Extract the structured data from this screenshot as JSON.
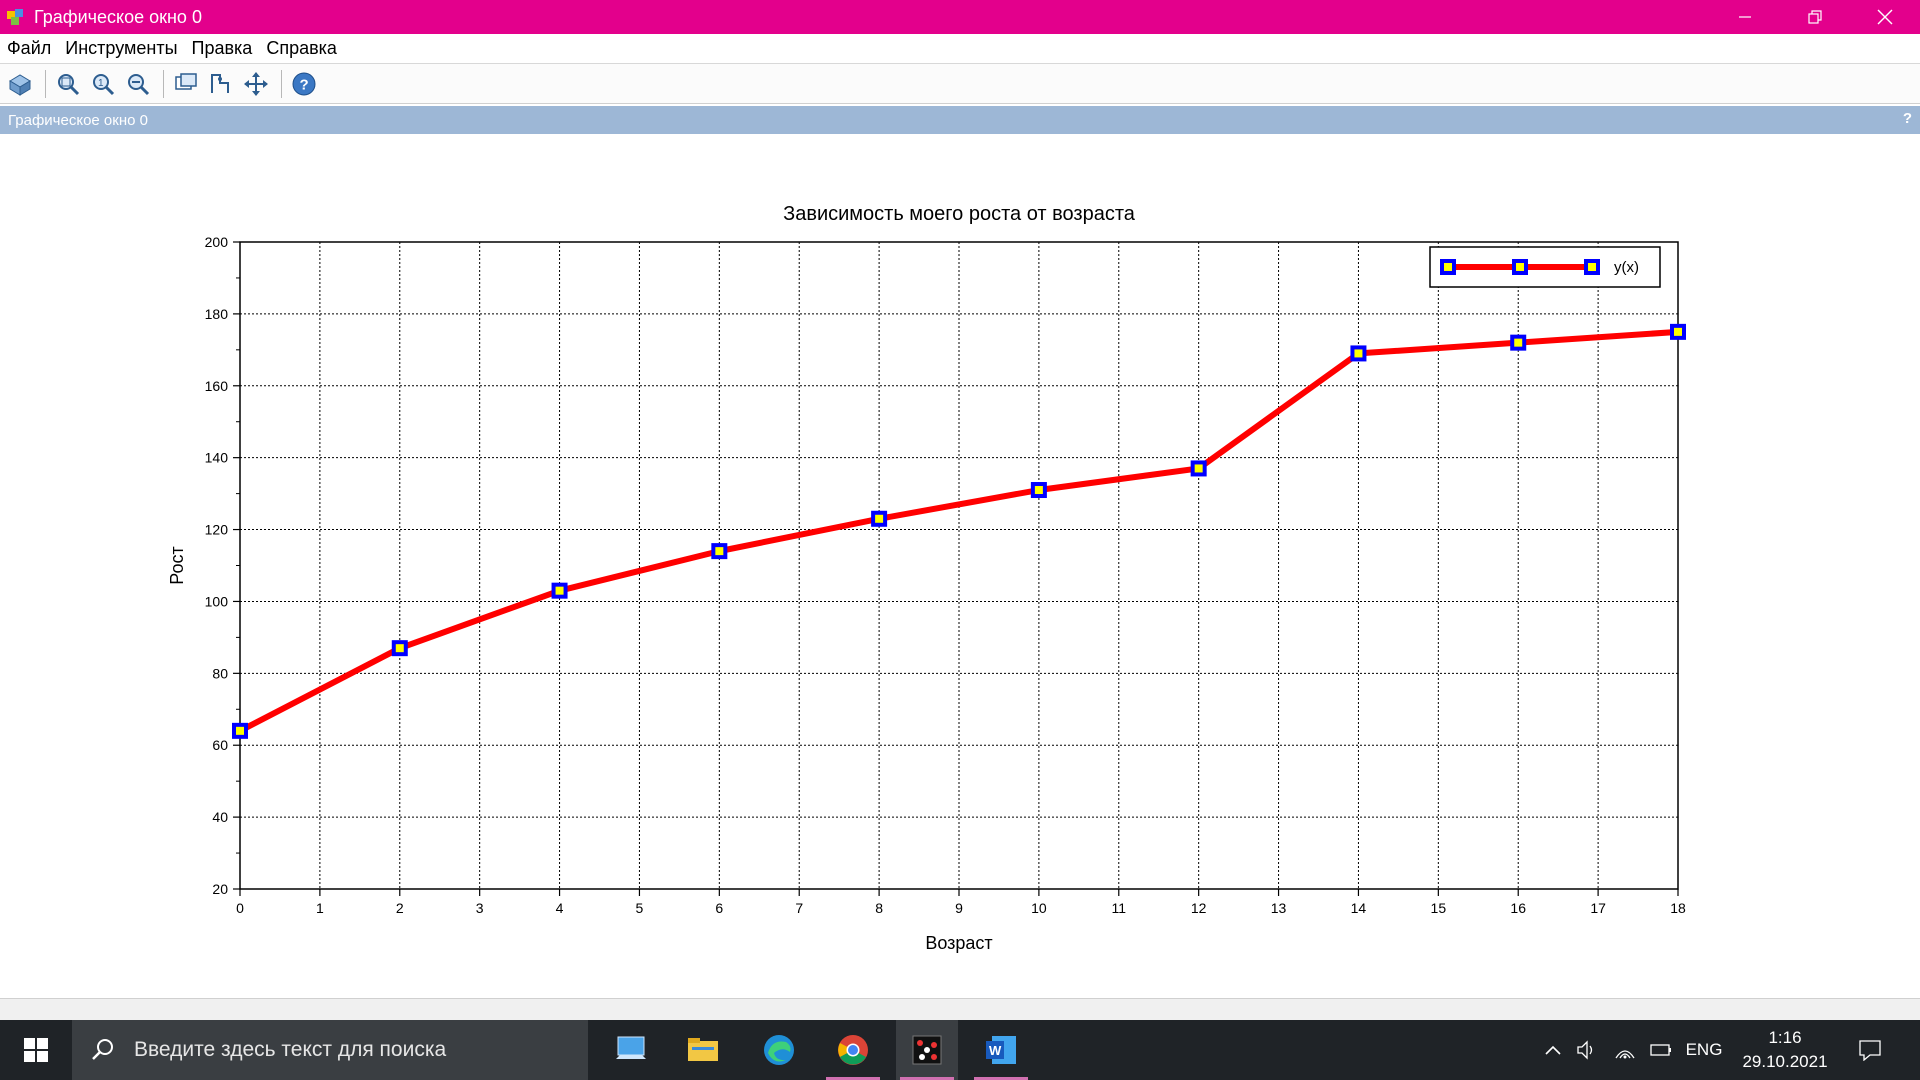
{
  "window": {
    "title": "Графическое окно 0",
    "controls": [
      "minimize",
      "restore",
      "close"
    ]
  },
  "menu": {
    "items": [
      "Файл",
      "Инструменты",
      "Правка",
      "Справка"
    ]
  },
  "toolbar": {
    "icons": [
      "rotate-icon",
      "zoom-area-icon",
      "zoom-in-icon",
      "zoom-out-icon",
      "datatip-icon",
      "edit-curve-icon",
      "pan-icon",
      "help-icon"
    ]
  },
  "panel": {
    "header": "Графическое окно 0",
    "help": "?"
  },
  "colors": {
    "titlebar": "#e3008c",
    "line": "#ff0000",
    "marker_edge": "#0000ff",
    "marker_face": "#ffff00"
  },
  "chart_data": {
    "type": "line",
    "title": "Зависимость моего роста от возраста",
    "xlabel": "Возраст",
    "ylabel": "Рост",
    "xlim": [
      0,
      18
    ],
    "ylim": [
      20,
      200
    ],
    "xticks": [
      0,
      1,
      2,
      3,
      4,
      5,
      6,
      7,
      8,
      9,
      10,
      11,
      12,
      13,
      14,
      15,
      16,
      17,
      18
    ],
    "yticks": [
      20,
      40,
      60,
      80,
      100,
      120,
      140,
      160,
      180,
      200
    ],
    "grid": true,
    "legend_position": "top-right",
    "series": [
      {
        "name": "y(x)",
        "x": [
          0,
          2,
          4,
          6,
          8,
          10,
          12,
          14,
          16,
          18
        ],
        "values": [
          64,
          87,
          103,
          114,
          123,
          131,
          137,
          169,
          172,
          175
        ]
      }
    ]
  },
  "taskbar": {
    "search_placeholder": "Введите здесь текст для поиска",
    "language": "ENG",
    "time": "1:16",
    "date": "29.10.2021"
  }
}
